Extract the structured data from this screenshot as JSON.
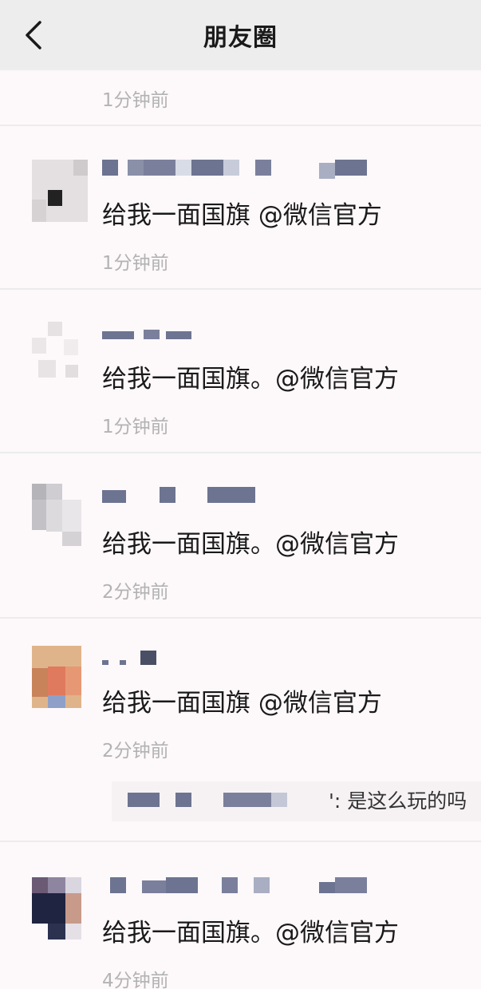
{
  "header": {
    "title": "朋友圈"
  },
  "first_time": "1分钟前",
  "posts": [
    {
      "content": "给我一面国旗 @微信官方",
      "time": "1分钟前"
    },
    {
      "content": "给我一面国旗。@微信官方",
      "time": "1分钟前"
    },
    {
      "content": "给我一面国旗。@微信官方",
      "time": "2分钟前"
    },
    {
      "content": "给我一面国旗 @微信官方",
      "time": "2分钟前",
      "reply": "': 是这么玩的吗"
    },
    {
      "content": "给我一面国旗。@微信官方",
      "time": "4分钟前"
    }
  ]
}
